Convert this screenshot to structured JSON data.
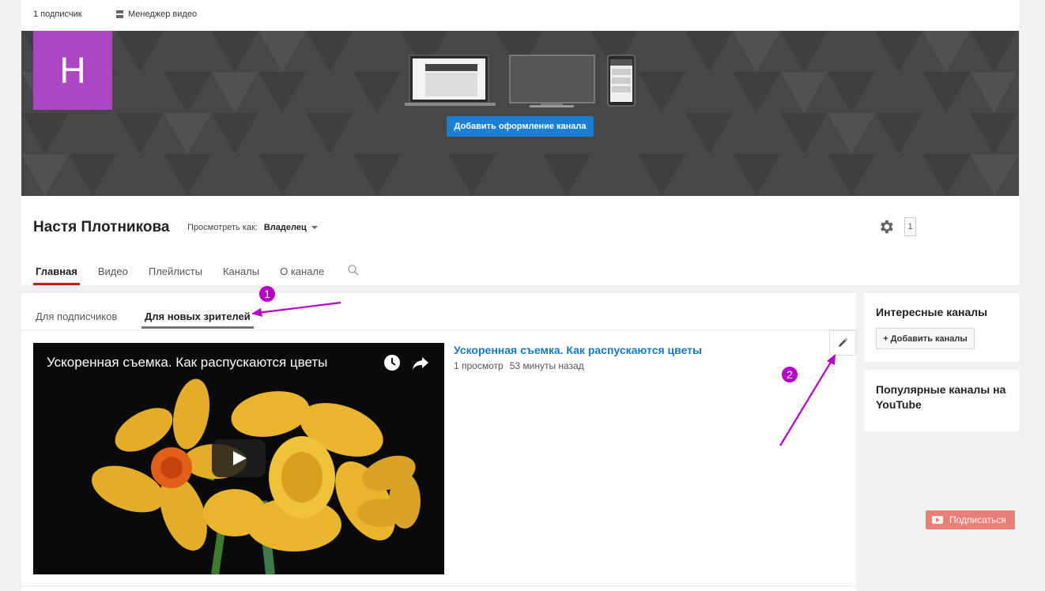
{
  "topbar": {
    "subscribers": "1 подписчик",
    "video_manager": "Менеджер видео"
  },
  "banner": {
    "avatar_letter": "Н",
    "add_art_label": "Добавить оформление канала",
    "avatar_color": "#ad46c3"
  },
  "channel": {
    "name": "Настя Плотникова",
    "view_as_label": "Просмотреть как:",
    "view_as_value": "Владелец",
    "subscribe_label": "Подписаться",
    "subscribe_count": "1"
  },
  "tabs": [
    "Главная",
    "Видео",
    "Плейлисты",
    "Каналы",
    "О канале"
  ],
  "subtabs": {
    "subscribers": "Для подписчиков",
    "new_viewers": "Для новых зрителей"
  },
  "video": {
    "title": "Ускоренная съемка. Как распускаются цветы",
    "views": "1 просмотр",
    "age": "53 минуты назад"
  },
  "sidebar": {
    "interesting_title": "Интересные каналы",
    "add_channels_label": "+ Добавить каналы",
    "popular_title": "Популярные каналы на YouTube"
  },
  "annotations": {
    "badge1": "1",
    "badge2": "2"
  },
  "colors": {
    "accent": "#b700c9",
    "link": "#167ac6",
    "subscribe": "#e62117"
  }
}
